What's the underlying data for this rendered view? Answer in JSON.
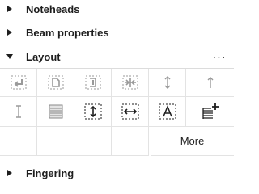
{
  "sections": {
    "noteheads": {
      "label": "Noteheads",
      "expanded": false
    },
    "beam_properties": {
      "label": "Beam properties",
      "expanded": false
    },
    "layout": {
      "label": "Layout",
      "expanded": true,
      "menu_glyph": "···"
    },
    "fingering": {
      "label": "Fingering",
      "expanded": false
    }
  },
  "layout_palette": {
    "row1": [
      {
        "icon": "system-break-icon",
        "enabled": false
      },
      {
        "icon": "page-break-icon",
        "enabled": false
      },
      {
        "icon": "section-break-icon",
        "enabled": false
      },
      {
        "icon": "keep-measures-icon",
        "enabled": false
      },
      {
        "icon": "staff-spacer-down-icon",
        "enabled": false
      },
      {
        "icon": "staff-spacer-up-icon",
        "enabled": false
      }
    ],
    "row2": [
      {
        "icon": "staff-spacer-fixed-icon",
        "enabled": false
      },
      {
        "icon": "horizontal-frame-icon",
        "enabled": false
      },
      {
        "icon": "vertical-spacer-icon",
        "enabled": true
      },
      {
        "icon": "horizontal-spacer-icon",
        "enabled": true
      },
      {
        "icon": "text-frame-icon",
        "enabled": true
      },
      {
        "icon": "add-staff-icon",
        "enabled": true
      }
    ],
    "more_label": "More"
  },
  "colors": {
    "enabled_icon": "#1e1e1e",
    "disabled_icon": "#9a9a9a",
    "grid_line": "#e3e3e3"
  }
}
